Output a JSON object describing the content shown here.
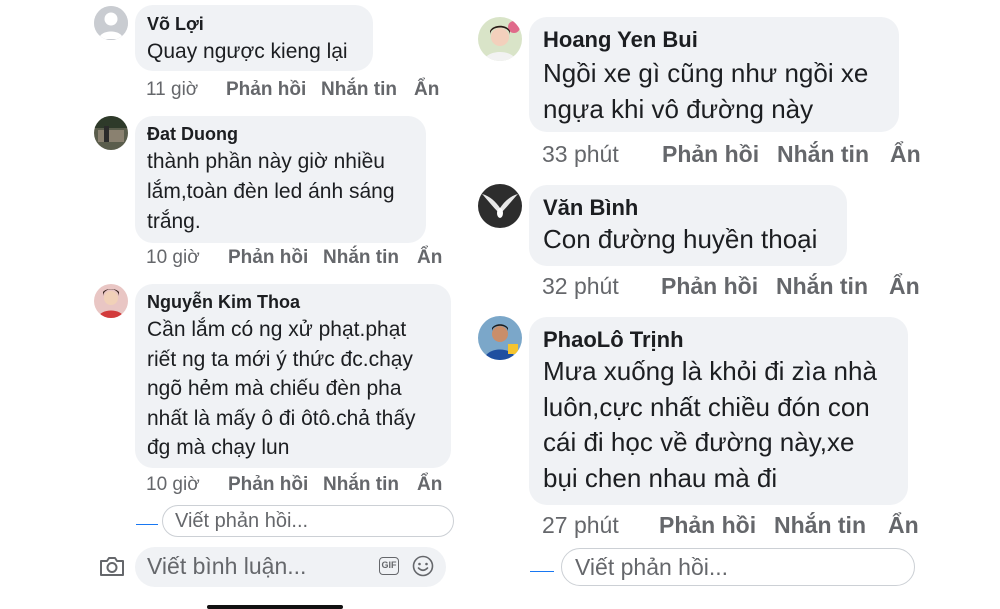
{
  "left": {
    "comments": [
      {
        "author": "Võ Lợi",
        "text": "Quay ngược kieng lại",
        "time": "11 giờ"
      },
      {
        "author": "Đat Duong",
        "text": "thành phần này giờ nhiều\nlắm,toàn đèn led ánh sáng\ntrắng.",
        "time": "10 giờ"
      },
      {
        "author": "Nguyễn Kim Thoa",
        "text": "Cần lắm có ng xử phạt.phạt\nriết ng ta mới ý thức đc.chạy\nngõ hẻm mà chiếu đèn pha\nnhất là mấy ô đi ôtô.chả thấy\nđg mà chạy lun",
        "time": "10 giờ"
      }
    ],
    "reply_placeholder": "Viết phản hồi...",
    "comment_placeholder": "Viết bình luận...",
    "gif_label": "GIF"
  },
  "right": {
    "comments": [
      {
        "author": "Hoang Yen Bui",
        "text": "Ngồi xe gì cũng như ngồi xe\nngựa khi vô đường này",
        "time": "33 phút"
      },
      {
        "author": "Văn Bình",
        "text": "Con đường huyền thoại",
        "time": "32 phút"
      },
      {
        "author": "PhaoLô Trịnh",
        "text": "Mưa xuống là khỏi đi zìa nhà\nluôn,cực nhất chiều đón con\ncái đi học về đường này,xe\nbụi chen nhau mà đi",
        "time": "27 phút"
      }
    ],
    "reply_placeholder": "Viết phản hồi..."
  },
  "actions": {
    "reply": "Phản hồi",
    "message": "Nhắn tin",
    "hide": "Ẩn"
  },
  "icons": {
    "camera": "camera-icon",
    "gif": "gif-icon",
    "emoji": "emoji-icon"
  },
  "colors": {
    "bubble": "#f0f2f5",
    "muted": "#65676b",
    "text": "#1c1e21"
  }
}
